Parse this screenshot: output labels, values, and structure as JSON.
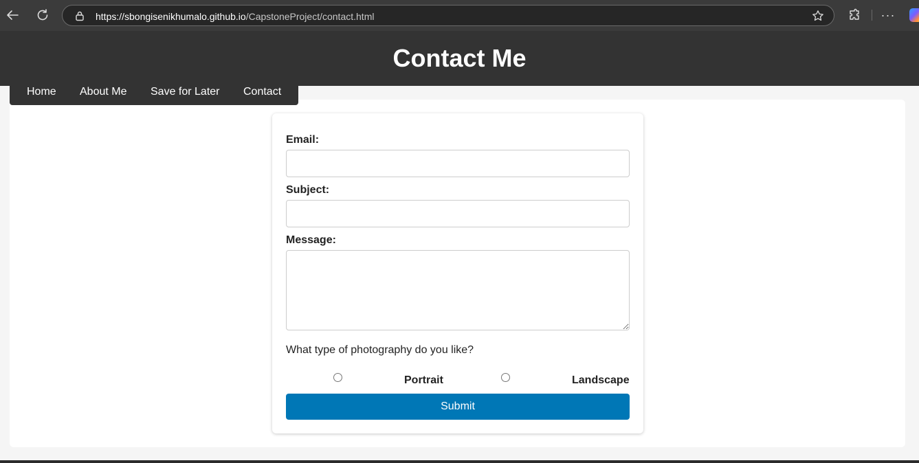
{
  "browser": {
    "url_host": "https://sbongisenikhumalo.github.io",
    "url_path": "/CapstoneProject/contact.html",
    "icons": [
      "back-icon",
      "reload-icon",
      "lock-icon",
      "star-icon",
      "extensions-icon",
      "more-icon",
      "copilot-icon"
    ]
  },
  "header": {
    "title": "Contact Me"
  },
  "nav": {
    "items": [
      {
        "label": "Home"
      },
      {
        "label": "About Me"
      },
      {
        "label": "Save for Later"
      },
      {
        "label": "Contact"
      }
    ]
  },
  "form": {
    "email_label": "Email:",
    "email_value": "",
    "subject_label": "Subject:",
    "subject_value": "",
    "message_label": "Message:",
    "message_value": "",
    "question": "What type of photography do you like?",
    "options": [
      {
        "label": "Portrait",
        "checked": false
      },
      {
        "label": "Landscape",
        "checked": false
      }
    ],
    "submit_label": "Submit"
  },
  "colors": {
    "header_bg": "#333333",
    "submit_bg": "#0077b6",
    "page_bg": "#f5f5f5"
  }
}
